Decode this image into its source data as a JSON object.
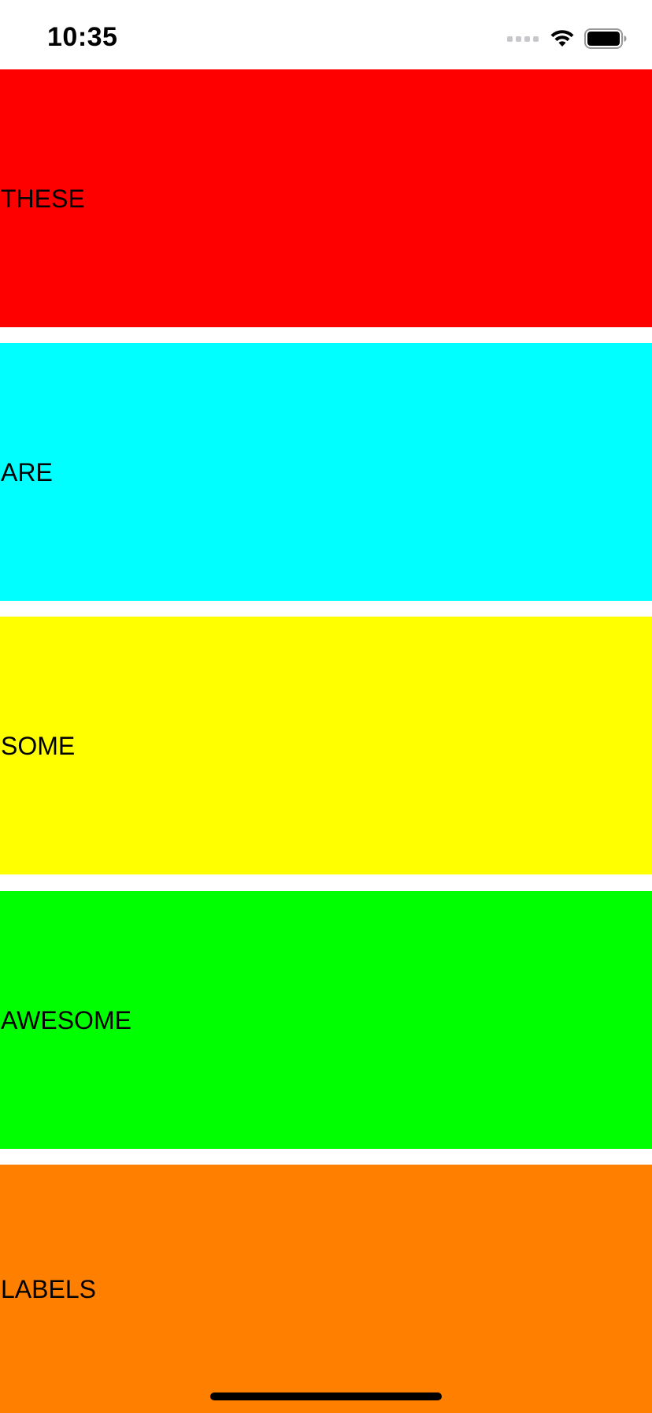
{
  "status_bar": {
    "time": "10:35",
    "icons": [
      "cellular-signal-icon",
      "wifi-icon",
      "battery-icon"
    ]
  },
  "labels": [
    {
      "text": "THESE",
      "color": "#ff0000"
    },
    {
      "text": "ARE",
      "color": "#00ffff"
    },
    {
      "text": "SOME",
      "color": "#ffff00"
    },
    {
      "text": "AWESOME",
      "color": "#00ff00"
    },
    {
      "text": "LABELS",
      "color": "#ff8000"
    }
  ]
}
